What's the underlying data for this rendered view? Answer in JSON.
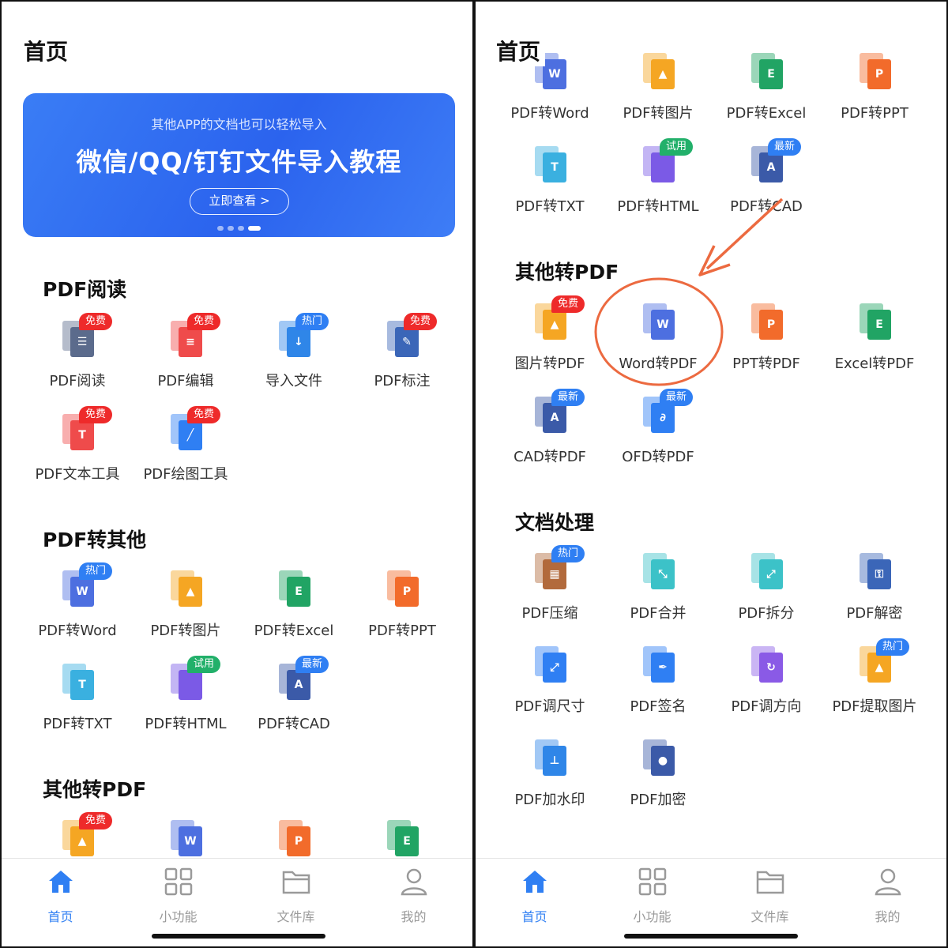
{
  "left": {
    "page_title": "首页",
    "banner": {
      "subtitle": "其他APP的文档也可以轻松导入",
      "title": "微信/QQ/钉钉文件导入教程",
      "button_label": "立即查看 >"
    },
    "sections": {
      "pdf_read": {
        "title": "PDF阅读",
        "items": [
          {
            "label": "PDF阅读",
            "badge": "免费",
            "icon": "book-icon"
          },
          {
            "label": "PDF编辑",
            "badge": "免费",
            "icon": "edit-doc-icon"
          },
          {
            "label": "导入文件",
            "badge": "热门",
            "icon": "import-icon"
          },
          {
            "label": "PDF标注",
            "badge": "免费",
            "icon": "pin-doc-icon"
          },
          {
            "label": "PDF文本工具",
            "badge": "免费",
            "icon": "text-tool-icon"
          },
          {
            "label": "PDF绘图工具",
            "badge": "免费",
            "icon": "draw-tool-icon"
          }
        ]
      },
      "pdf_to_other": {
        "title": "PDF转其他",
        "items": [
          {
            "label": "PDF转Word",
            "badge": "热门",
            "icon": "word-icon"
          },
          {
            "label": "PDF转图片",
            "badge": "",
            "icon": "image-icon"
          },
          {
            "label": "PDF转Excel",
            "badge": "",
            "icon": "excel-icon"
          },
          {
            "label": "PDF转PPT",
            "badge": "",
            "icon": "ppt-icon"
          },
          {
            "label": "PDF转TXT",
            "badge": "",
            "icon": "txt-icon"
          },
          {
            "label": "PDF转HTML",
            "badge": "试用",
            "icon": "html-icon"
          },
          {
            "label": "PDF转CAD",
            "badge": "最新",
            "icon": "cad-icon"
          }
        ]
      },
      "other_to_pdf": {
        "title": "其他转PDF",
        "items": [
          {
            "badge": "免费",
            "icon": "image-icon"
          },
          {
            "badge": "",
            "icon": "word-icon"
          },
          {
            "badge": "",
            "icon": "ppt-icon"
          },
          {
            "badge": "",
            "icon": "excel-icon"
          }
        ]
      }
    }
  },
  "right": {
    "page_title": "首页",
    "top_items": [
      {
        "label": "PDF转Word",
        "icon": "word-icon"
      },
      {
        "label": "PDF转图片",
        "icon": "image-icon"
      },
      {
        "label": "PDF转Excel",
        "icon": "excel-icon"
      },
      {
        "label": "PDF转PPT",
        "icon": "ppt-icon"
      },
      {
        "label": "PDF转TXT",
        "badge": "",
        "icon": "txt-icon"
      },
      {
        "label": "PDF转HTML",
        "badge": "试用",
        "icon": "html-icon"
      },
      {
        "label": "PDF转CAD",
        "badge": "最新",
        "icon": "cad-icon"
      }
    ],
    "sections": {
      "other_to_pdf": {
        "title": "其他转PDF",
        "items": [
          {
            "label": "图片转PDF",
            "badge": "免费",
            "icon": "image-icon"
          },
          {
            "label": "Word转PDF",
            "badge": "",
            "icon": "word-icon"
          },
          {
            "label": "PPT转PDF",
            "badge": "",
            "icon": "ppt-icon"
          },
          {
            "label": "Excel转PDF",
            "badge": "",
            "icon": "excel-icon"
          },
          {
            "label": "CAD转PDF",
            "badge": "最新",
            "icon": "cad-icon"
          },
          {
            "label": "OFD转PDF",
            "badge": "最新",
            "icon": "ofd-icon"
          }
        ]
      },
      "doc_processing": {
        "title": "文档处理",
        "items": [
          {
            "label": "PDF压缩",
            "badge": "热门",
            "icon": "zip-icon"
          },
          {
            "label": "PDF合并",
            "badge": "",
            "icon": "merge-icon"
          },
          {
            "label": "PDF拆分",
            "badge": "",
            "icon": "split-icon"
          },
          {
            "label": "PDF解密",
            "badge": "",
            "icon": "unlock-icon"
          },
          {
            "label": "PDF调尺寸",
            "badge": "",
            "icon": "resize-icon"
          },
          {
            "label": "PDF签名",
            "badge": "",
            "icon": "pen-icon"
          },
          {
            "label": "PDF调方向",
            "badge": "",
            "icon": "rotate-icon"
          },
          {
            "label": "PDF提取图片",
            "badge": "热门",
            "icon": "extract-image-icon"
          },
          {
            "label": "PDF加水印",
            "badge": "",
            "icon": "stamp-icon"
          },
          {
            "label": "PDF加密",
            "badge": "",
            "icon": "shield-icon"
          }
        ]
      }
    }
  },
  "tabbar": {
    "tabs": [
      {
        "label": "首页",
        "icon": "home-icon",
        "active": true
      },
      {
        "label": "小功能",
        "icon": "grid-icon",
        "active": false
      },
      {
        "label": "文件库",
        "icon": "folder-icon",
        "active": false
      },
      {
        "label": "我的",
        "icon": "user-icon",
        "active": false
      }
    ]
  },
  "colors": {
    "accent": "#2f7ff3",
    "badge_free": "#ee2a2a",
    "badge_trial": "#22b06a",
    "annotation": "#ec6a40"
  }
}
